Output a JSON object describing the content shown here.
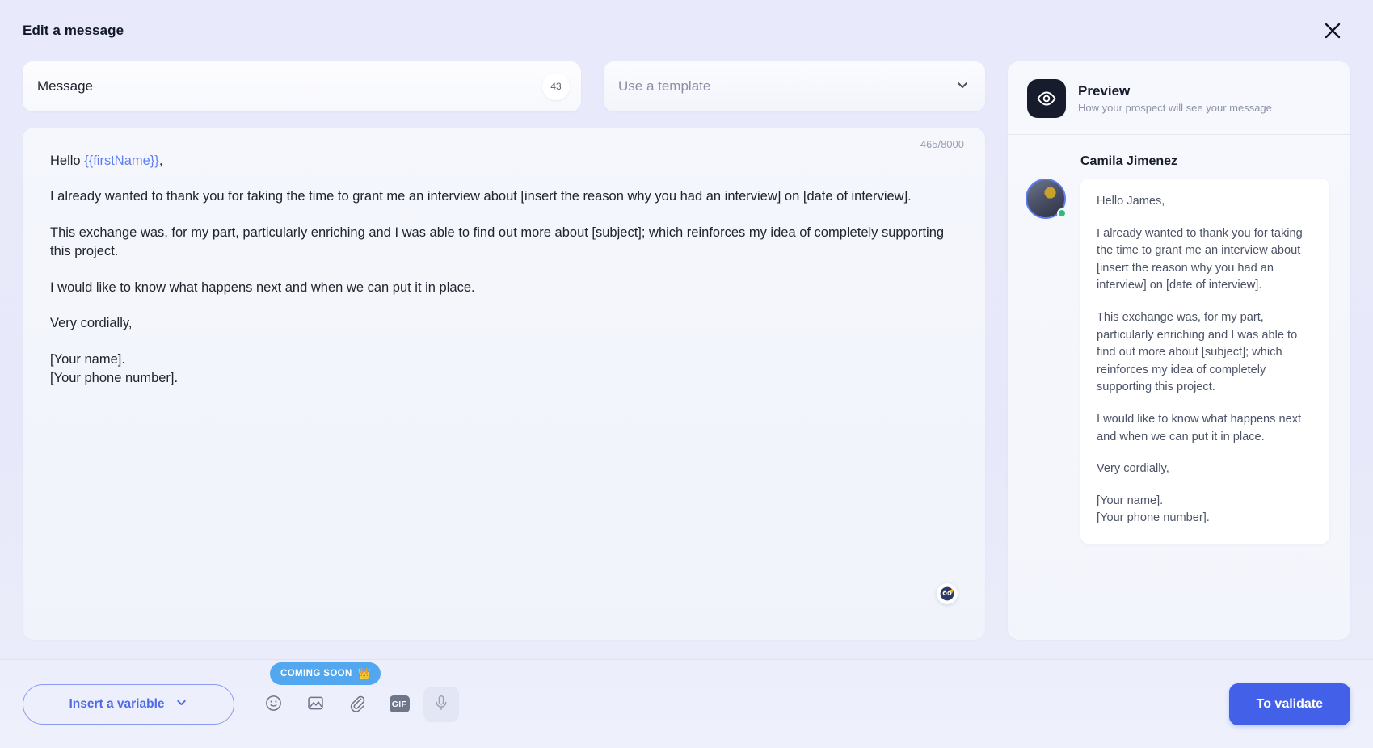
{
  "header": {
    "title": "Edit a message",
    "close_icon": "close-icon"
  },
  "message_field": {
    "label": "Message",
    "badge_count": "43"
  },
  "template_select": {
    "placeholder": "Use a template",
    "chevron_icon": "chevron-down-icon"
  },
  "editor": {
    "counter": "465/8000",
    "ai_icon": "ai-assistant-icon",
    "paragraphs": [
      {
        "before": "Hello ",
        "variable": "{{firstName}}",
        "after": ","
      },
      {
        "text": "I already wanted to thank you for taking the time to grant me an interview about [insert the reason why you had an interview] on [date of interview]."
      },
      {
        "text": "This exchange was, for my part, particularly enriching and I was able to find out more about [subject]; which reinforces my idea of completely supporting this project."
      },
      {
        "text": "I would like to know what happens next and when we can put it in place."
      },
      {
        "text": "Very cordially,"
      },
      {
        "text": "[Your name].\n[Your phone number]."
      }
    ]
  },
  "preview": {
    "icon": "eye-icon",
    "title": "Preview",
    "subtitle": "How your prospect will see your message",
    "prospect_name": "Camila Jimenez",
    "avatar_status": "online",
    "bubble": [
      "Hello James,",
      "I already wanted to thank you for taking the time to grant me an interview about [insert the reason why you had an interview] on [date of interview].",
      "This exchange was, for my part, particularly enriching and I was able to find out more about [subject]; which reinforces my idea of completely supporting this project.",
      "I would like to know what happens next and when we can put it in place.",
      "Very cordially,",
      "[Your name].\n[Your phone number]."
    ]
  },
  "footer": {
    "insert_variable_label": "Insert a variable",
    "insert_variable_chevron": "chevron-down-icon",
    "tools": [
      {
        "name": "emoji-icon",
        "label": "Emoji"
      },
      {
        "name": "image-icon",
        "label": "Image"
      },
      {
        "name": "attachment-icon",
        "label": "Attachment"
      },
      {
        "name": "gif-icon",
        "label": "GIF"
      },
      {
        "name": "microphone-icon",
        "label": "Voice message"
      }
    ],
    "gif_label": "GIF",
    "coming_soon_label": "COMING SOON",
    "coming_soon_crown": "👑",
    "validate_label": "To validate"
  },
  "colors": {
    "background": "#e7e9fa",
    "accent": "#4361e8",
    "variable": "#5f7df0",
    "badge": "#53a7ef",
    "online": "#2fbd74",
    "dark_tile": "#171c2c"
  }
}
